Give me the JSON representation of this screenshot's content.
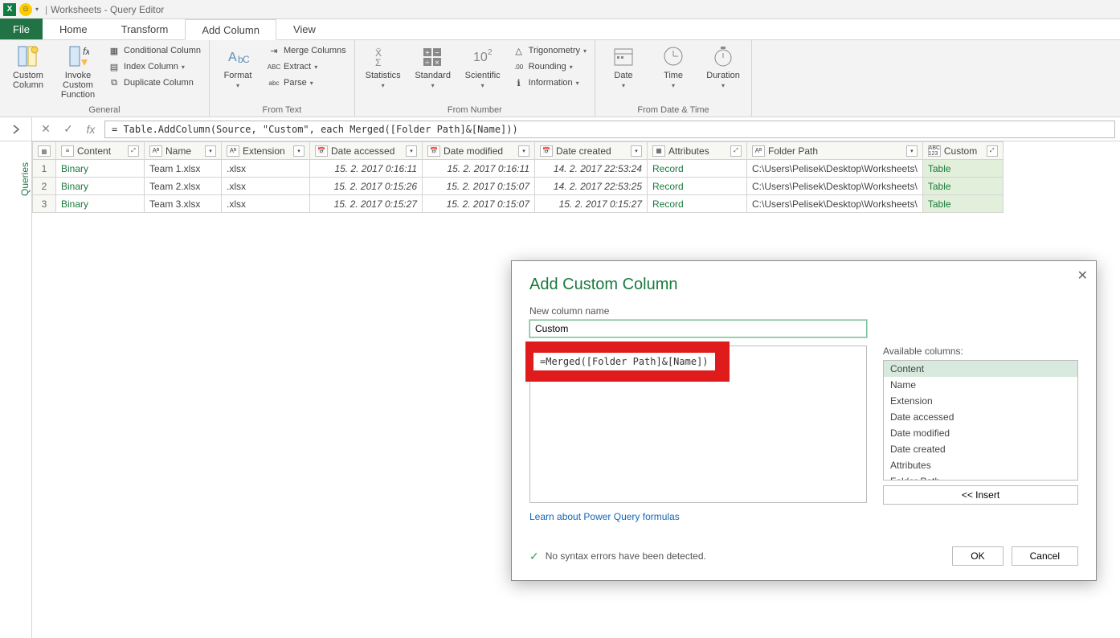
{
  "titlebar": {
    "title": "Worksheets - Query Editor"
  },
  "tabs": {
    "file": "File",
    "home": "Home",
    "transform": "Transform",
    "addcolumn": "Add Column",
    "view": "View"
  },
  "ribbon": {
    "general": {
      "custom_column": "Custom Column",
      "invoke_custom_function": "Invoke Custom Function",
      "conditional_column": "Conditional Column",
      "index_column": "Index Column",
      "duplicate_column": "Duplicate Column",
      "label": "General"
    },
    "fromtext": {
      "format": "Format",
      "merge_columns": "Merge Columns",
      "extract": "Extract",
      "parse": "Parse",
      "label": "From Text"
    },
    "fromnumber": {
      "statistics": "Statistics",
      "standard": "Standard",
      "scientific": "Scientific",
      "trigonometry": "Trigonometry",
      "rounding": "Rounding",
      "information": "Information",
      "label": "From Number"
    },
    "fromdatetime": {
      "date": "Date",
      "time": "Time",
      "duration": "Duration",
      "label": "From Date & Time"
    }
  },
  "formula_bar": {
    "formula": "= Table.AddColumn(Source, \"Custom\", each Merged([Folder Path]&[Name]))"
  },
  "queries_side_label": "Queries",
  "columns": {
    "content": "Content",
    "name": "Name",
    "extension": "Extension",
    "date_accessed": "Date accessed",
    "date_modified": "Date modified",
    "date_created": "Date created",
    "attributes": "Attributes",
    "folder_path": "Folder Path",
    "custom": "Custom"
  },
  "rows": [
    {
      "n": "1",
      "content": "Binary",
      "name": "Team 1.xlsx",
      "ext": ".xlsx",
      "acc": "15. 2. 2017 0:16:11",
      "mod": "15. 2. 2017 0:16:11",
      "cre": "14. 2. 2017 22:53:24",
      "attr": "Record",
      "path": "C:\\Users\\Pelisek\\Desktop\\Worksheets\\",
      "custom": "Table"
    },
    {
      "n": "2",
      "content": "Binary",
      "name": "Team 2.xlsx",
      "ext": ".xlsx",
      "acc": "15. 2. 2017 0:15:26",
      "mod": "15. 2. 2017 0:15:07",
      "cre": "14. 2. 2017 22:53:25",
      "attr": "Record",
      "path": "C:\\Users\\Pelisek\\Desktop\\Worksheets\\",
      "custom": "Table"
    },
    {
      "n": "3",
      "content": "Binary",
      "name": "Team 3.xlsx",
      "ext": ".xlsx",
      "acc": "15. 2. 2017 0:15:27",
      "mod": "15. 2. 2017 0:15:07",
      "cre": "15. 2. 2017 0:15:27",
      "attr": "Record",
      "path": "C:\\Users\\Pelisek\\Desktop\\Worksheets\\",
      "custom": "Table"
    }
  ],
  "dialog": {
    "title": "Add Custom Column",
    "new_column_name_label": "New column name",
    "new_column_name_value": "Custom",
    "formula": "=Merged([Folder Path]&[Name])",
    "available_columns_label": "Available columns:",
    "available_columns": [
      "Content",
      "Name",
      "Extension",
      "Date accessed",
      "Date modified",
      "Date created",
      "Attributes",
      "Folder Path"
    ],
    "insert_label": "<< Insert",
    "learn_link": "Learn about Power Query formulas",
    "syntax_ok": "No syntax errors have been detected.",
    "ok": "OK",
    "cancel": "Cancel"
  }
}
